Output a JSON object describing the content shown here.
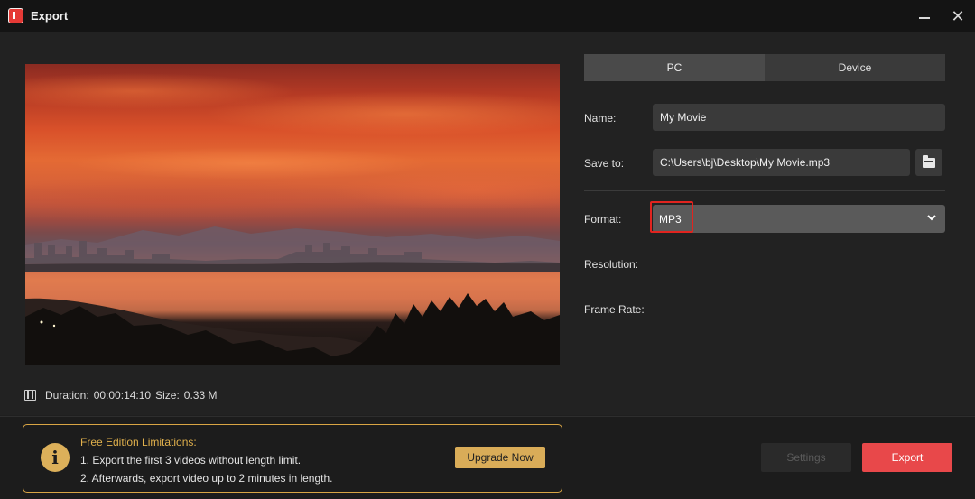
{
  "window": {
    "title": "Export",
    "minimize_icon": "minimize-icon",
    "close_symbol": "✕"
  },
  "preview": {
    "image_name": "sunset-city-coast-image"
  },
  "info": {
    "duration_label": "Duration:",
    "duration_value": "00:00:14:10",
    "size_label": "Size:",
    "size_value": "0.33 M"
  },
  "tabs": [
    {
      "label": "PC",
      "active": true
    },
    {
      "label": "Device",
      "active": false
    }
  ],
  "form": {
    "name_label": "Name:",
    "name_value": "My Movie",
    "save_label": "Save to:",
    "save_value": "C:\\Users\\bj\\Desktop\\My Movie.mp3",
    "format_label": "Format:",
    "format_value": "MP3",
    "resolution_label": "Resolution:",
    "frame_rate_label": "Frame Rate:"
  },
  "notice": {
    "title": "Free Edition Limitations:",
    "line1": "1. Export the first 3 videos without length limit.",
    "line2": "2. Afterwards, export video up to 2 minutes in length.",
    "icon_symbol": "i",
    "upgrade_label": "Upgrade Now"
  },
  "actions": {
    "settings_label": "Settings",
    "export_label": "Export"
  },
  "colors": {
    "accent": "#e8484a",
    "gold": "#d9ac58",
    "highlight": "#e1241f",
    "background": "#222222"
  }
}
